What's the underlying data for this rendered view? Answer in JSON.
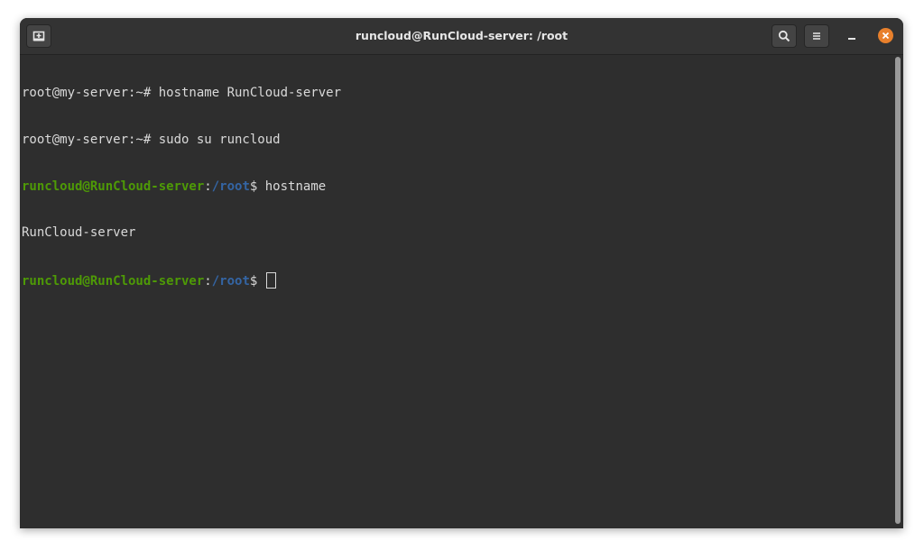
{
  "window": {
    "title": "runcloud@RunCloud-server: /root"
  },
  "titlebar": {
    "new_tab_icon": "new-tab-icon",
    "search_icon": "search-icon",
    "menu_icon": "hamburger-menu-icon",
    "minimize_icon": "minimize-icon",
    "close_icon": "close-icon",
    "minimize_glyph": "–",
    "menu_glyph": "≡",
    "close_glyph": "✕"
  },
  "colors": {
    "background": "#2e2e2e",
    "text": "#d9d9d9",
    "user_host": "#4e9a06",
    "path": "#3465a4",
    "close_button": "#e8802c"
  },
  "terminal": {
    "lines": [
      {
        "text": "root@my-server:~# hostname RunCloud-server"
      },
      {
        "text": "root@my-server:~# sudo su runcloud"
      },
      {
        "user_host": "runcloud@RunCloud-server",
        "sep": ":",
        "path": "/root",
        "prompt": "$ ",
        "command": "hostname"
      },
      {
        "text": "RunCloud-server"
      },
      {
        "user_host": "runcloud@RunCloud-server",
        "sep": ":",
        "path": "/root",
        "prompt": "$ ",
        "command": ""
      }
    ]
  }
}
